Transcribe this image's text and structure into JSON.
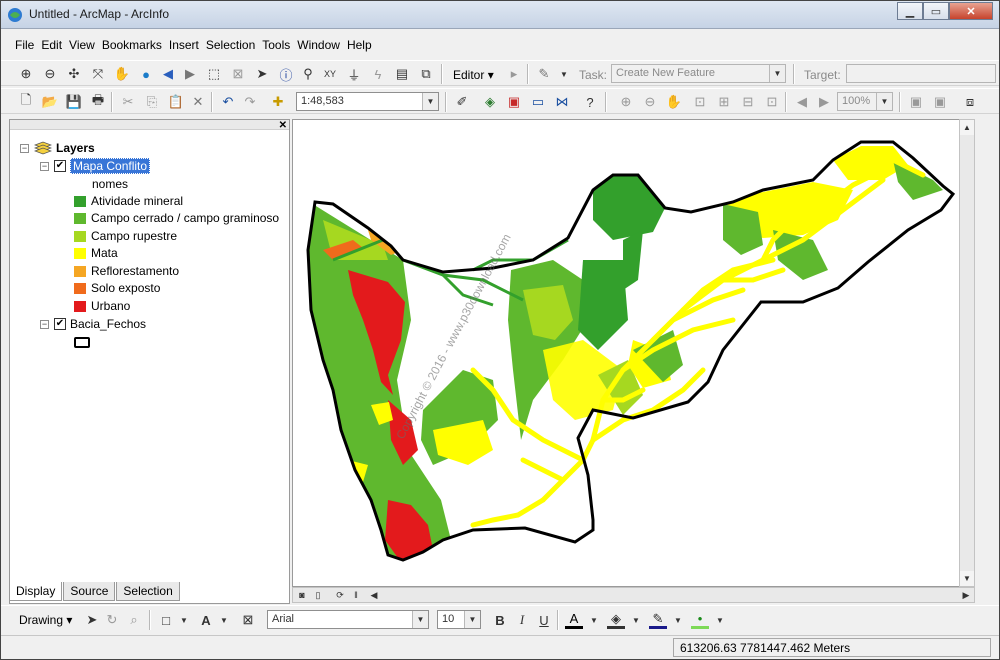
{
  "window": {
    "title": "Untitled - ArcMap - ArcInfo",
    "minimize": "▁",
    "maximize": "▭",
    "close": "✕"
  },
  "menu": [
    "File",
    "Edit",
    "View",
    "Bookmarks",
    "Insert",
    "Selection",
    "Tools",
    "Window",
    "Help"
  ],
  "standard_toolbar": {
    "editor_label": "Editor",
    "task_label": "Task:",
    "task_value": "Create New Feature",
    "target_label": "Target:",
    "scale_value": "1:48,583",
    "zoom_value": "100%"
  },
  "toc": {
    "root_label": "Layers",
    "layers": [
      {
        "name": "Mapa Conflito",
        "checked": true,
        "field": "nomes",
        "classes": [
          {
            "label": "Atividade mineral",
            "color": "#33a02c"
          },
          {
            "label": "Campo cerrado / campo graminoso",
            "color": "#5fb82e"
          },
          {
            "label": "Campo rupestre",
            "color": "#a6d820"
          },
          {
            "label": "Mata",
            "color": "#ffff00"
          },
          {
            "label": "Reflorestamento",
            "color": "#f5a623"
          },
          {
            "label": "Solo exposto",
            "color": "#f06b1c"
          },
          {
            "label": "Urbano",
            "color": "#e31a1c"
          }
        ]
      },
      {
        "name": "Bacia_Fechos",
        "checked": true
      }
    ],
    "tabs": [
      "Display",
      "Source",
      "Selection"
    ]
  },
  "map": {
    "watermark": "Copyright © 2016 - www.p30download.com"
  },
  "drawing_toolbar": {
    "drawing_label": "Drawing",
    "font_name": "Arial",
    "font_size": "10",
    "bold": "B",
    "italic": "I",
    "underline": "U"
  },
  "status": {
    "coordinates": "613206.63  7781447.462 Meters"
  }
}
